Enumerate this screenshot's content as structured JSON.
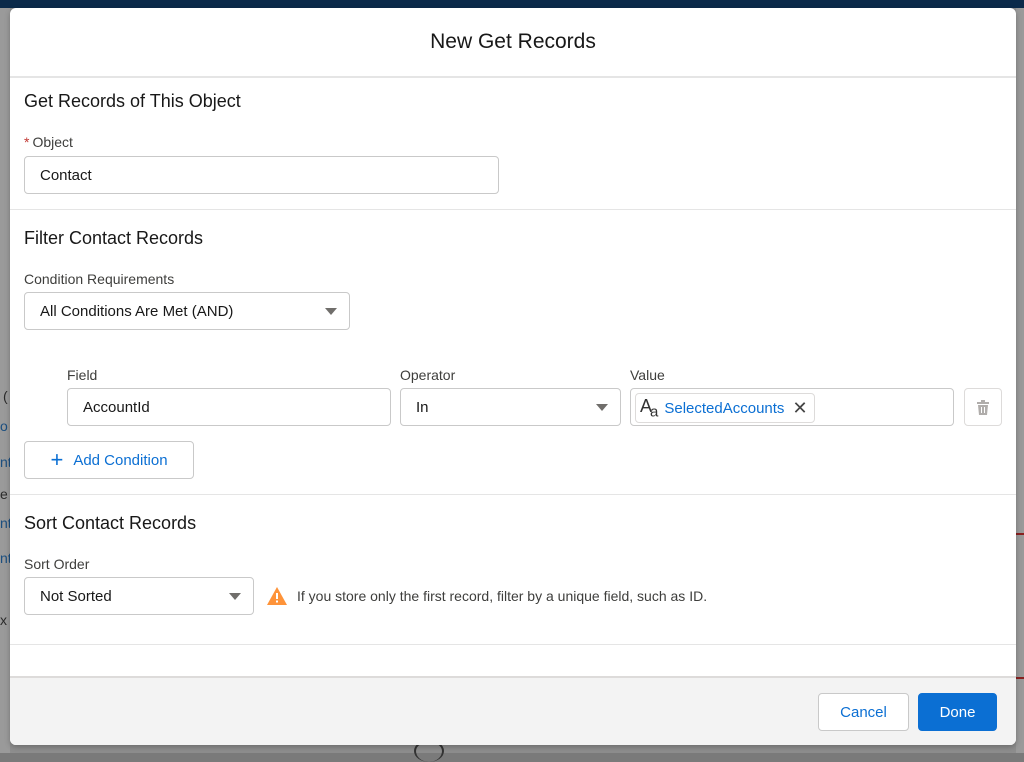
{
  "modal": {
    "title": "New Get Records"
  },
  "object_section": {
    "title": "Get Records of This Object",
    "object_label": "Object",
    "required_mark": "*",
    "object_value": "Contact"
  },
  "filter_section": {
    "title": "Filter Contact Records",
    "condition_requirements_label": "Condition Requirements",
    "condition_requirements_value": "All Conditions Are Met (AND)",
    "condition": {
      "field_label": "Field",
      "field_value": "AccountId",
      "operator_label": "Operator",
      "operator_value": "In",
      "value_label": "Value",
      "value_pill_icon": "text-type-icon",
      "value_pill_text": "SelectedAccounts"
    },
    "add_condition_label": "Add Condition"
  },
  "sort_section": {
    "title": "Sort Contact Records",
    "sort_order_label": "Sort Order",
    "sort_order_value": "Not Sorted",
    "warning_text": "If you store only the first record, filter by a unique field, such as ID."
  },
  "footer": {
    "cancel_label": "Cancel",
    "done_label": "Done"
  },
  "background_fragments": [
    "(",
    "o",
    "nt",
    "e",
    "nt",
    "nt",
    "x"
  ],
  "colors": {
    "accent": "#0b6fd3",
    "required": "#c23934",
    "warning": "#fe9339",
    "footer_bg": "#f3f3f3"
  }
}
